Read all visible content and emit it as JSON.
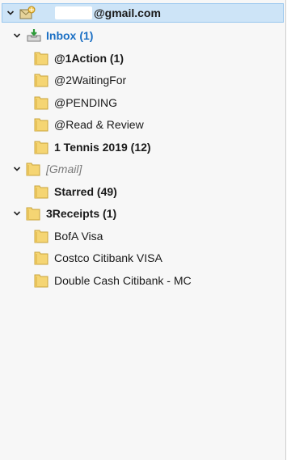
{
  "account": {
    "email_suffix": "@gmail.com",
    "icon": "mail-account-icon"
  },
  "folders": {
    "inbox": {
      "label": "Inbox",
      "count": "(1)",
      "icon": "inbox-icon"
    },
    "action": "@1Action (1)",
    "waiting": "@2WaitingFor",
    "pending": "@PENDING",
    "read_review": "@Read & Review",
    "tennis": "1 Tennis 2019 (12)",
    "gmail": "[Gmail]",
    "starred": "Starred (49)",
    "receipts": "3Receipts (1)",
    "bofa": "BofA Visa",
    "costco": "Costco Citibank VISA",
    "double_cash": "Double Cash Citibank - MC"
  },
  "colors": {
    "selection_bg": "#cde4f7",
    "selection_border": "#99c7ee",
    "inbox_text": "#1a6fc4",
    "folder_fill": "#f5d573"
  }
}
